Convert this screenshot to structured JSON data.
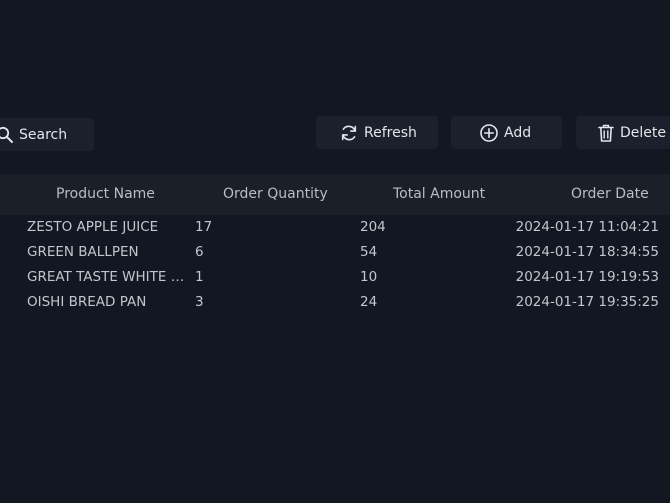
{
  "toolbar": {
    "search_label": "Search",
    "refresh_label": "Refresh",
    "add_label": "Add",
    "delete_label": "Delete"
  },
  "table": {
    "columns": [
      "Product Name",
      "Order Quantity",
      "Total Amount",
      "Order Date"
    ],
    "rows": [
      {
        "product": "ZESTO APPLE JUICE",
        "quantity": "17",
        "amount": "204",
        "date": "2024-01-17 11:04:21"
      },
      {
        "product": "GREEN BALLPEN",
        "quantity": "6",
        "amount": "54",
        "date": "2024-01-17 18:34:55"
      },
      {
        "product": "GREAT TASTE WHITE COFFEE",
        "quantity": "1",
        "amount": "10",
        "date": "2024-01-17 19:19:53"
      },
      {
        "product": "OISHI BREAD PAN",
        "quantity": "3",
        "amount": "24",
        "date": "2024-01-17 19:35:25"
      }
    ]
  },
  "icons": {
    "search": "search-icon",
    "refresh": "refresh-icon",
    "add": "plus-circle-icon",
    "delete": "trash-icon"
  },
  "colors": {
    "background": "#121721",
    "button": "#1b212c",
    "header": "#1a1f28",
    "text": "#c2c6ce"
  }
}
